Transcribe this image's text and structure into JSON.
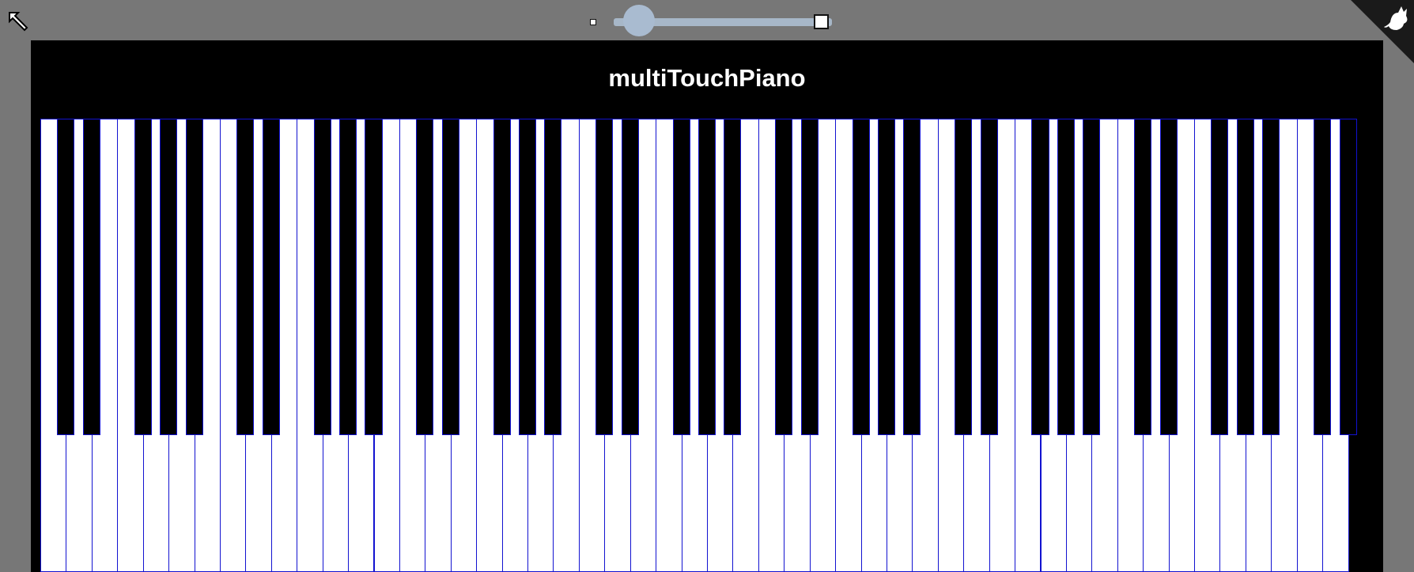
{
  "app": {
    "title": "multiTouchPiano"
  },
  "toolbar": {
    "shrink_icon": "arrow-up-left-icon",
    "zoom": {
      "min_icon": "small-square-icon",
      "max_icon": "large-square-icon",
      "level": 0.08
    },
    "corner_icon": "cat-silhouette-icon"
  },
  "piano": {
    "octave_pattern": [
      "white",
      "black",
      "white",
      "black",
      "white",
      "white",
      "black",
      "white",
      "black",
      "white",
      "black",
      "white"
    ],
    "first_note": "A",
    "white_key_count": 52,
    "black_key_count": 36,
    "key_color_white": "#ffffff",
    "key_color_black": "#000000",
    "key_border_color": "#1212d0"
  },
  "colors": {
    "background": "#777777",
    "stage": "#000000",
    "slider_track": "#a7b7c8",
    "slider_thumb": "#a9bbd0"
  }
}
